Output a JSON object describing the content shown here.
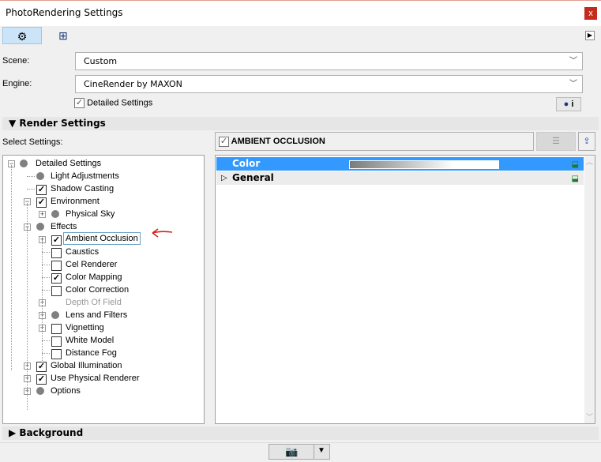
{
  "window": {
    "title": "PhotoRendering Settings",
    "close": "x"
  },
  "toolbar": {
    "settings_icon": "gear-icon",
    "size_icon": "size-icon",
    "expand": "▶"
  },
  "scene": {
    "label": "Scene:",
    "value": "Custom"
  },
  "engine": {
    "label": "Engine:",
    "value": "CineRender by MAXON"
  },
  "detailed": {
    "label": "Detailed Settings",
    "checked": true
  },
  "render_settings": {
    "title": "Render Settings",
    "select_label": "Select Settings:"
  },
  "tree": [
    {
      "label": "Detailed Settings",
      "level": 0,
      "mark": "dot",
      "expander": "-"
    },
    {
      "label": "Light Adjustments",
      "level": 1,
      "mark": "dot",
      "expander": ""
    },
    {
      "label": "Shadow Casting",
      "level": 1,
      "mark": "checked",
      "expander": ""
    },
    {
      "label": "Environment",
      "level": 1,
      "mark": "checked",
      "expander": "-"
    },
    {
      "label": "Physical Sky",
      "level": 2,
      "mark": "dot",
      "expander": "+"
    },
    {
      "label": "Effects",
      "level": 1,
      "mark": "dot",
      "expander": "-"
    },
    {
      "label": "Ambient Occlusion",
      "level": 2,
      "mark": "checked",
      "expander": "+",
      "selected": true
    },
    {
      "label": "Caustics",
      "level": 2,
      "mark": "unchecked",
      "expander": ""
    },
    {
      "label": "Cel Renderer",
      "level": 2,
      "mark": "unchecked",
      "expander": ""
    },
    {
      "label": "Color Mapping",
      "level": 2,
      "mark": "checked",
      "expander": ""
    },
    {
      "label": "Color Correction",
      "level": 2,
      "mark": "unchecked",
      "expander": ""
    },
    {
      "label": "Depth Of Field",
      "level": 2,
      "mark": "none",
      "expander": "+",
      "disabled": true
    },
    {
      "label": "Lens and Filters",
      "level": 2,
      "mark": "dot",
      "expander": "+"
    },
    {
      "label": "Vignetting",
      "level": 2,
      "mark": "unchecked",
      "expander": "+"
    },
    {
      "label": "White Model",
      "level": 2,
      "mark": "unchecked",
      "expander": ""
    },
    {
      "label": "Distance Fog",
      "level": 2,
      "mark": "unchecked",
      "expander": ""
    },
    {
      "label": "Global Illumination",
      "level": 1,
      "mark": "checked",
      "expander": "+"
    },
    {
      "label": "Use Physical Renderer",
      "level": 1,
      "mark": "checked",
      "expander": "+"
    },
    {
      "label": "Options",
      "level": 1,
      "mark": "dot",
      "expander": "+"
    }
  ],
  "right": {
    "header": "AMBIENT OCCLUSION",
    "rows": [
      {
        "label": "Color"
      },
      {
        "label": "General"
      }
    ]
  },
  "background": {
    "title": "Background"
  },
  "colors": {
    "selection": "#3399ff",
    "annotation_arrow": "#d42020"
  }
}
